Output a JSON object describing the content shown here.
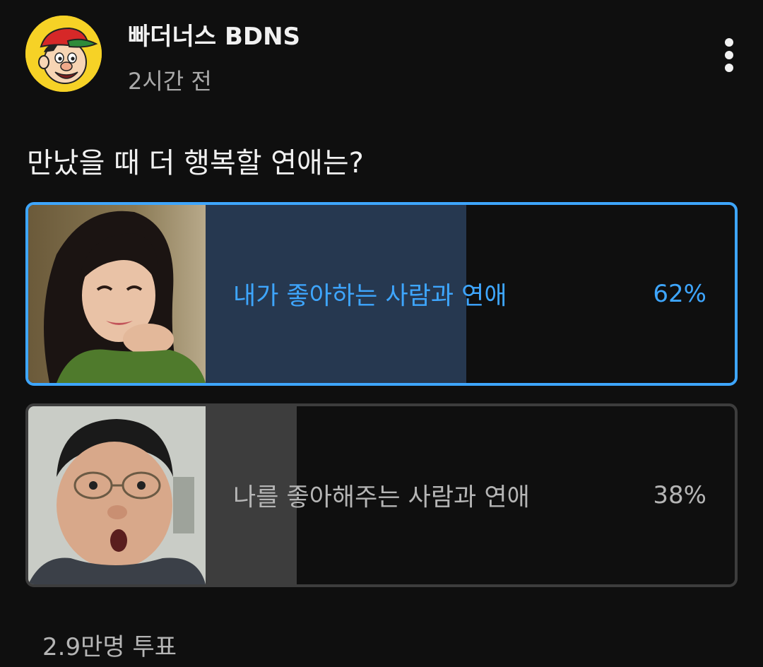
{
  "channel": {
    "name": "빠더너스 BDNS",
    "time": "2시간 전",
    "avatar_icon": "cartoon-boy-cap-avatar"
  },
  "poll": {
    "question": "만났을 때 더 행복할 연애는?",
    "options": [
      {
        "label": "내가 좋아하는 사람과 연애",
        "percent_text": "62%",
        "percent": 62,
        "selected": true,
        "thumbnail": "smiling-woman-photo"
      },
      {
        "label": "나를 좋아해주는 사람과 연애",
        "percent_text": "38%",
        "percent": 38,
        "selected": false,
        "thumbnail": "surprised-man-photo"
      }
    ],
    "vote_count": "2.9만명 투표"
  },
  "colors": {
    "background": "#0f0f0f",
    "accent": "#3ea6ff",
    "selected_fill": "#263850",
    "unselected_fill": "#3d3d3d",
    "secondary_text": "#aaaaaa"
  },
  "icons": {
    "more": "more-vertical-icon"
  }
}
